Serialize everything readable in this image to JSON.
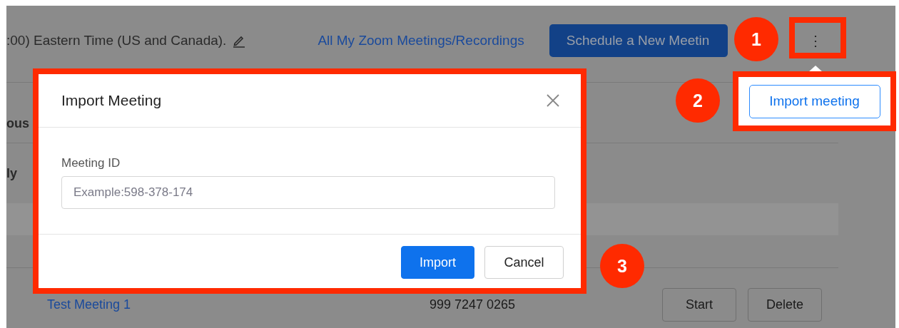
{
  "header": {
    "timezone_text": ":00) Eastern Time (US and Canada).",
    "link": "All My Zoom Meetings/Recordings",
    "schedule_button": "Schedule a New Meetin",
    "more_button": "⋮"
  },
  "section_labels": [
    "ous",
    "ly"
  ],
  "meeting_row": {
    "topic": "Test Meeting 1",
    "meeting_id": "999 7247 0265",
    "buttons": [
      "Start",
      "Delete"
    ]
  },
  "modal": {
    "title": "Import Meeting",
    "field_label": "Meeting ID",
    "placeholder": "Example:598-378-174",
    "buttons": [
      {
        "label": "Import",
        "kind": "primary"
      },
      {
        "label": "Cancel",
        "kind": "default"
      }
    ]
  },
  "popover": {
    "button": "Import meeting"
  },
  "annotations": [
    {
      "label": "1"
    },
    {
      "label": "2"
    },
    {
      "label": "3"
    }
  ]
}
